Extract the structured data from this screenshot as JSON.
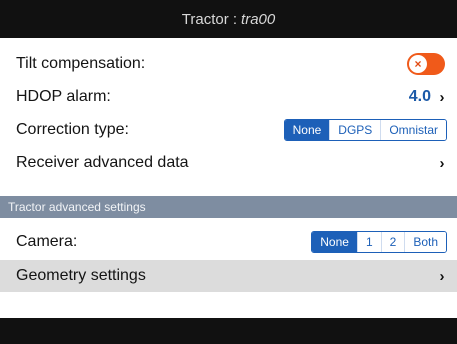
{
  "header": {
    "title": "Tractor :",
    "name": "tra00"
  },
  "rows": {
    "tilt": {
      "label": "Tilt compensation:",
      "toggle_symbol": "×",
      "toggle_state": "off"
    },
    "hdop": {
      "label": "HDOP alarm:",
      "value": "4.0",
      "chevron": "›"
    },
    "correction": {
      "label": "Correction type:",
      "options": [
        "None",
        "DGPS",
        "Omnistar"
      ],
      "selected": "None"
    },
    "receiver": {
      "label": "Receiver advanced data",
      "chevron": "›"
    }
  },
  "section": {
    "title": "Tractor advanced settings"
  },
  "advanced": {
    "camera": {
      "label": "Camera:",
      "options": [
        "None",
        "1",
        "2",
        "Both"
      ],
      "selected": "None"
    },
    "geometry": {
      "label": "Geometry settings",
      "chevron": "›"
    }
  },
  "colors": {
    "accent": "#1d60b8",
    "toggle": "#f05a1a",
    "section_bg": "#7e8da1",
    "bar": "#111111"
  },
  "icons": {
    "toggle": "close-icon",
    "chevron": "chevron-right-icon"
  }
}
